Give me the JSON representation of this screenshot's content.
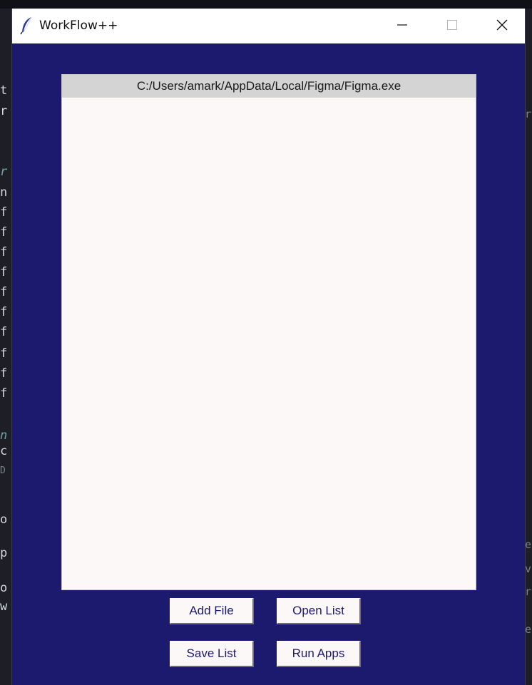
{
  "background_editor": {
    "left_chars": [
      {
        "ch": "t"
      },
      {
        "ch": "r"
      },
      {
        "ch": "r"
      },
      {
        "ch": "n"
      },
      {
        "ch": "f"
      },
      {
        "ch": "f"
      },
      {
        "ch": "f"
      },
      {
        "ch": "f"
      },
      {
        "ch": "f"
      },
      {
        "ch": "f"
      },
      {
        "ch": "f"
      },
      {
        "ch": "f"
      },
      {
        "ch": "f"
      },
      {
        "ch": "f"
      },
      {
        "ch": "n"
      },
      {
        "ch": "c"
      },
      {
        "ch": "D"
      },
      {
        "ch": "o"
      },
      {
        "ch": "p"
      },
      {
        "ch": "o"
      },
      {
        "ch": "w"
      }
    ],
    "right_chars": [
      {
        "ch": "r"
      },
      {
        "ch": "e"
      },
      {
        "ch": "v"
      },
      {
        "ch": "r"
      },
      {
        "ch": "e"
      }
    ]
  },
  "window": {
    "title": "WorkFlow++",
    "controls": {
      "minimize": "minimize",
      "maximize": "maximize",
      "close": "close"
    },
    "colors": {
      "background": "#1c1a6e",
      "listbox": "#fdf8f8",
      "selected_row": "#d4d4d4",
      "button_text": "#1c1a6e"
    }
  },
  "listbox": {
    "items": [
      "C:/Users/amark/AppData/Local/Figma/Figma.exe"
    ]
  },
  "buttons": {
    "add_file": "Add File",
    "open_list": "Open List",
    "save_list": "Save List",
    "run_apps": "Run Apps"
  },
  "icons": {
    "app_icon": "feather-icon",
    "minimize": "minimize-icon",
    "maximize": "maximize-icon",
    "close": "close-icon"
  }
}
